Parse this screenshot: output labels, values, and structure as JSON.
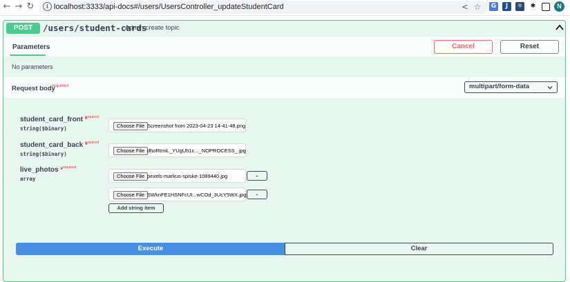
{
  "browser": {
    "back_icon": "arrow-left-icon",
    "forward_icon": "arrow-right-icon",
    "reload_icon": "reload-icon",
    "url": "localhost:3333/api-docs#/users/UsersController_updateStudentCard",
    "profile_initial": "N"
  },
  "operation": {
    "method": "POST",
    "path": "/users/student-cards",
    "description": "Admin create topic",
    "method_color": "#49cc90"
  },
  "params_header": {
    "tab_label": "Parameters",
    "cancel_label": "Cancel",
    "reset_label": "Reset",
    "no_params": "No parameters"
  },
  "request_body": {
    "label": "Request body",
    "required_label": "required",
    "content_type": "multipart/form-data"
  },
  "fields": {
    "front": {
      "name": "student_card_front",
      "star": "*",
      "required": "required",
      "type": "string($binary)",
      "choose_label": "Choose File",
      "file": "Screenshot from 2023-04-23 14-41-48.png"
    },
    "back": {
      "name": "student_card_back",
      "star": "*",
      "required": "required",
      "type": "string($binary)",
      "choose_label": "Choose File",
      "file": "dhoRtmiL_YUgUh1c..._NOPROCESS_.jpg"
    },
    "photos": {
      "name": "live_photos",
      "star": "*",
      "required": "required",
      "type": "array",
      "items": [
        {
          "choose_label": "Choose File",
          "file": "pexels-markus-spiske-1089440.jpg",
          "remove_label": "-"
        },
        {
          "choose_label": "Choose File",
          "file": "SWknFE1HSNFcUI...wCOd_3UcY5WX.jpg",
          "remove_label": "-"
        }
      ],
      "add_label": "Add string item"
    }
  },
  "actions": {
    "execute_label": "Execute",
    "clear_label": "Clear",
    "execute_color": "#4990e2"
  }
}
